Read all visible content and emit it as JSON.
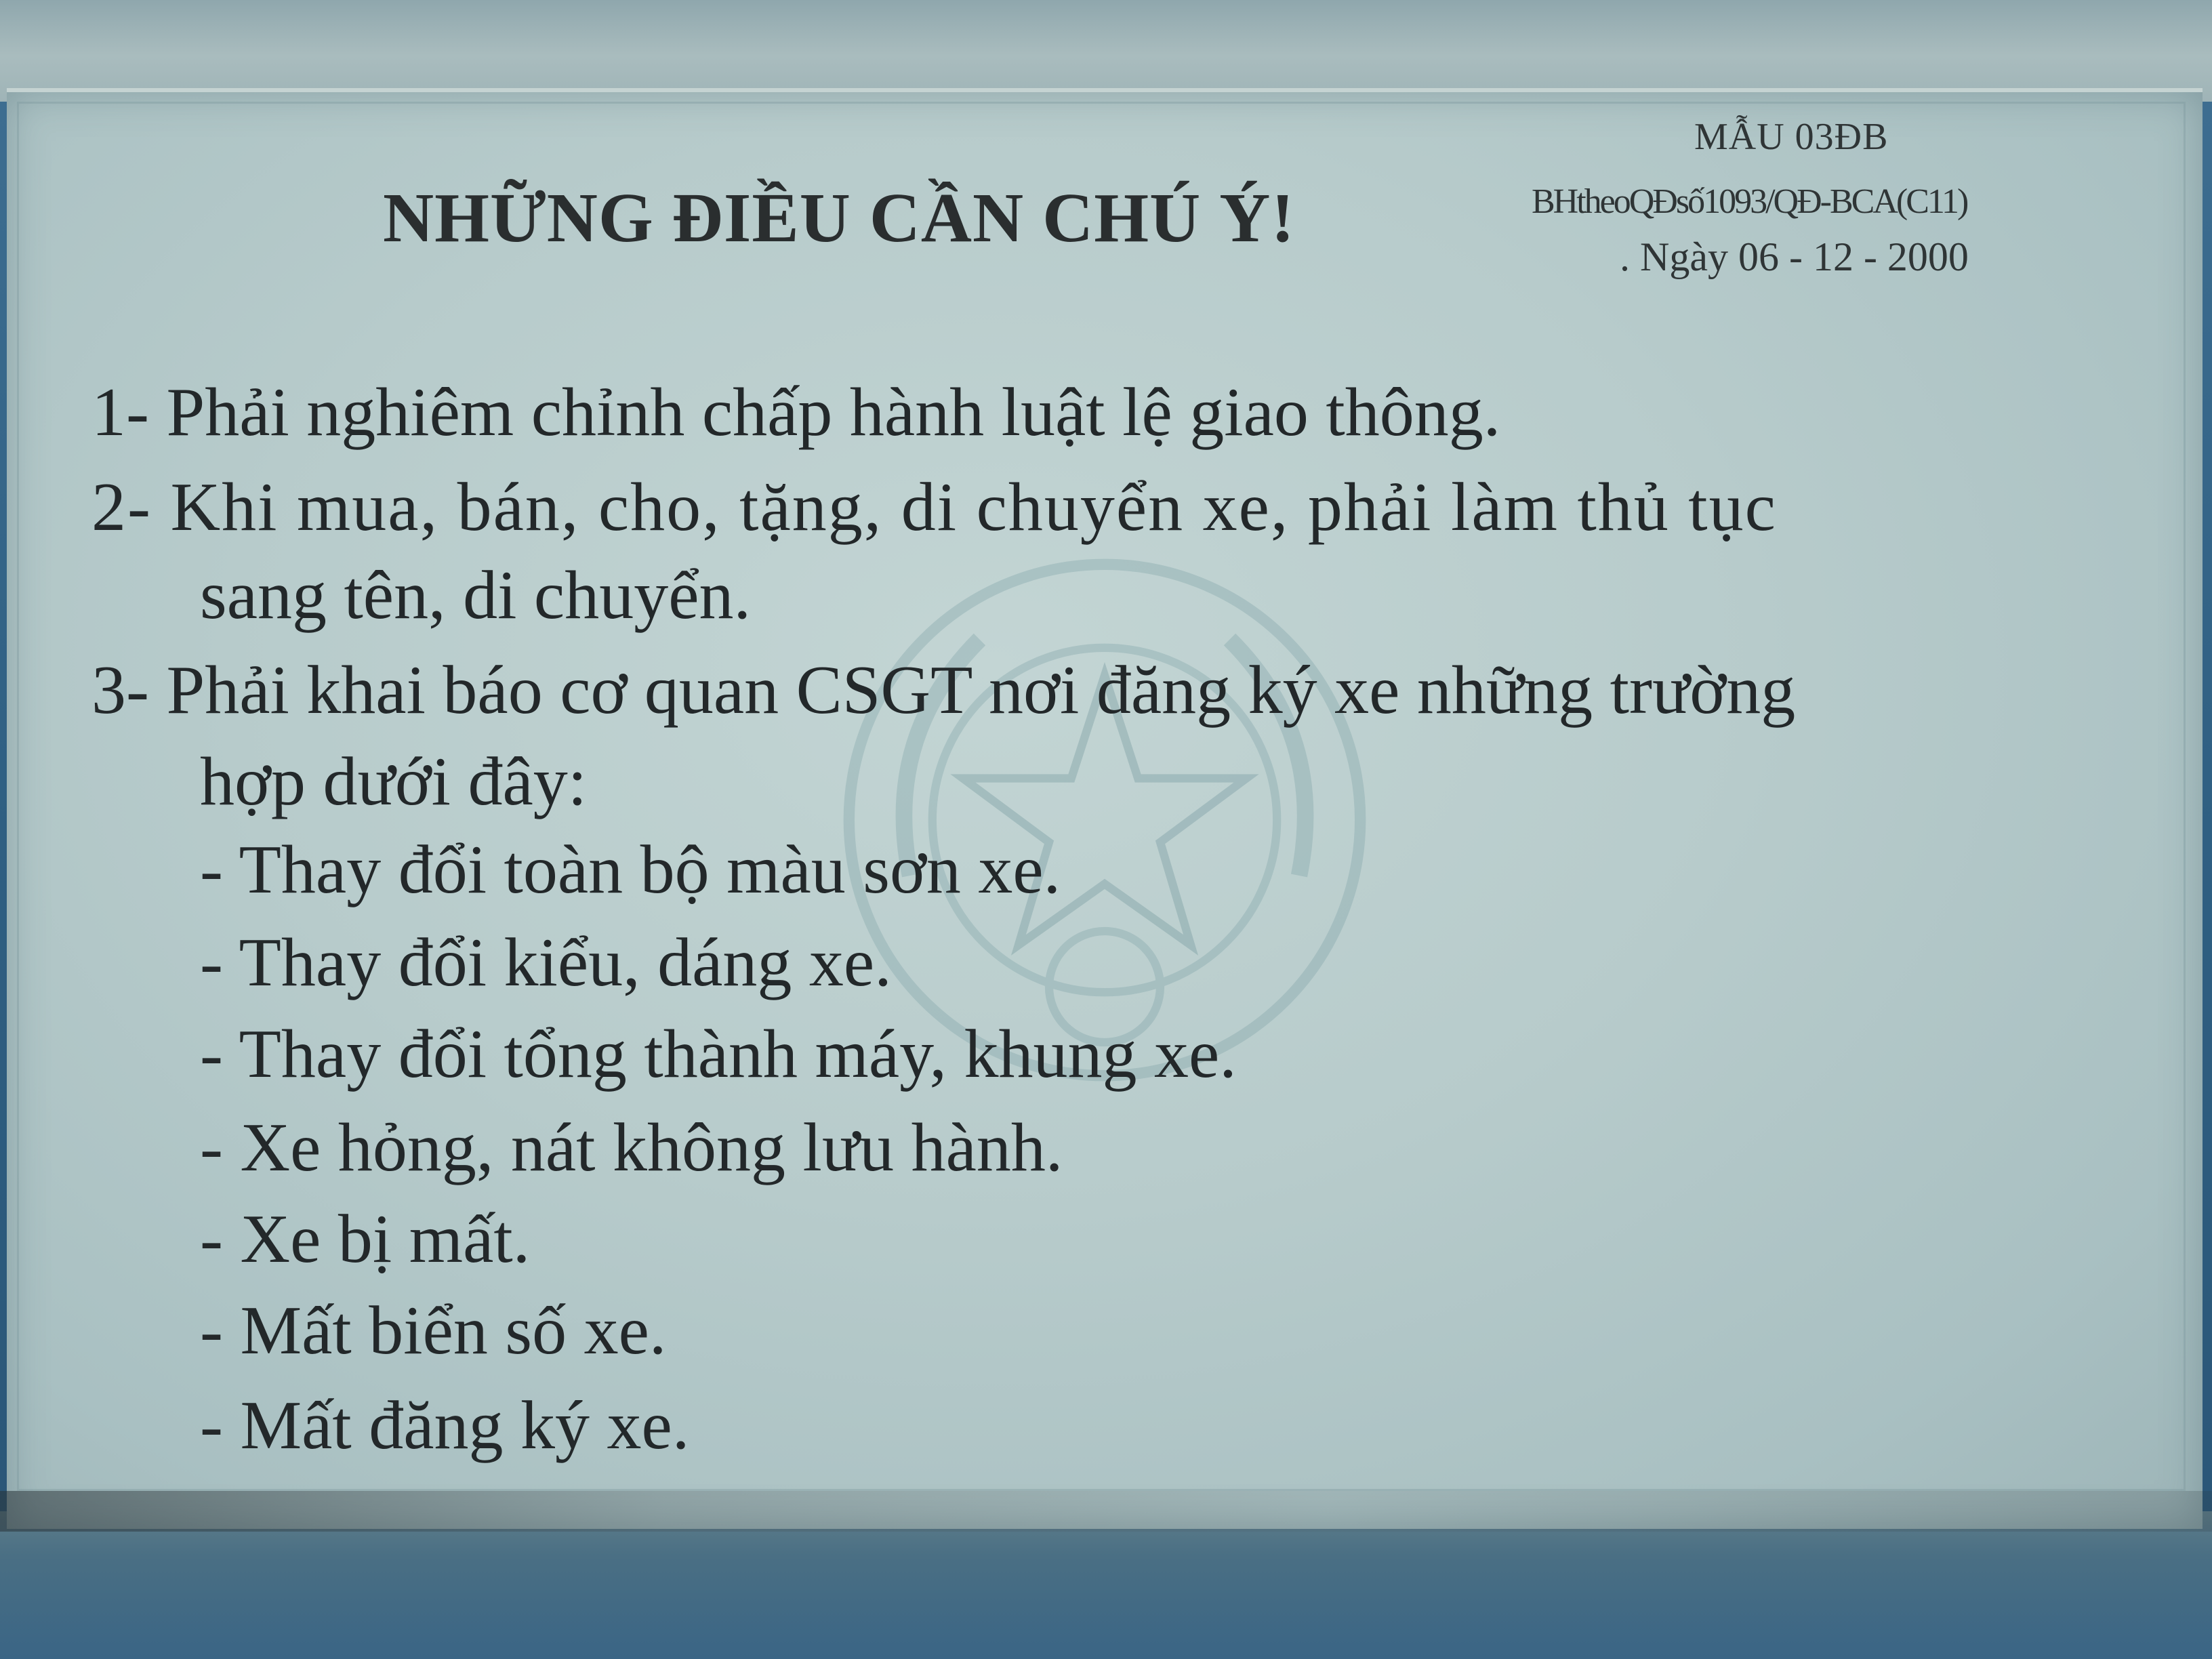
{
  "card": {
    "form_code": "MẪU 03ĐB",
    "form_ref": "BHtheoQĐsố1093/QĐ-BCA(C11)",
    "form_date": ". Ngày 06 - 12 - 2000",
    "title": "NHỮNG ĐIỀU CẦN CHÚ Ý!",
    "items": [
      {
        "line1": "1- Phải nghiêm chỉnh chấp hành luật lệ giao thông."
      },
      {
        "line1": "2- Khi mua, bán, cho, tặng, di chuyển xe, phải làm thủ tục",
        "line2": "sang tên, di chuyển."
      },
      {
        "line1": "3- Phải khai báo cơ quan CSGT nơi đăng ký xe những trường",
        "line2": "hợp dưới đây:"
      }
    ],
    "sub_items": [
      "- Thay đổi toàn bộ màu sơn xe.",
      "- Thay đổi kiểu, dáng xe.",
      "- Thay đổi tổng thành máy, khung xe.",
      "- Xe hỏng, nát không lưu hành.",
      "- Xe bị mất.",
      "- Mất biển số xe.",
      "- Mất đăng ký xe."
    ]
  },
  "colors": {
    "card_background": "#b7cbcb",
    "text": "#23282a",
    "backdrop": "#2f5f82"
  },
  "icons": {
    "emblem": "national-emblem-watermark"
  }
}
